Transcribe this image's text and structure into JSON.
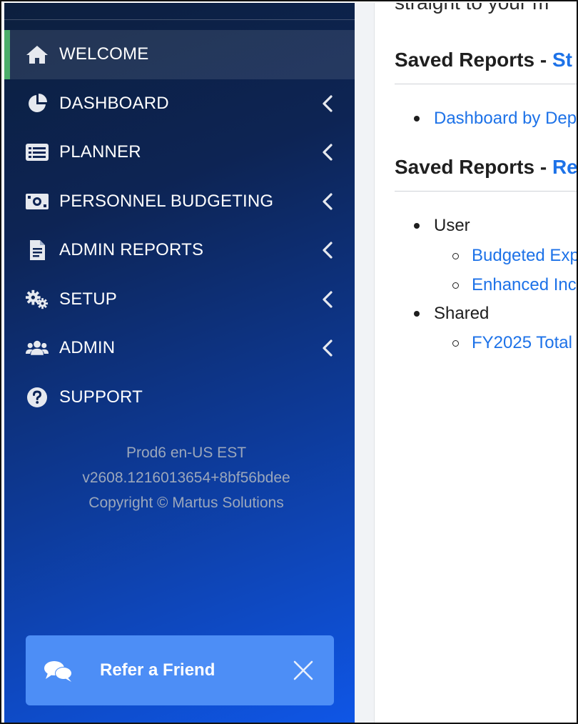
{
  "nav": {
    "items": [
      {
        "label": "WELCOME",
        "icon": "home-icon",
        "active": true
      },
      {
        "label": "DASHBOARD",
        "icon": "pie-chart-icon"
      },
      {
        "label": "PLANNER",
        "icon": "list-icon"
      },
      {
        "label": "PERSONNEL BUDGETING",
        "icon": "money-icon"
      },
      {
        "label": "ADMIN REPORTS",
        "icon": "report-icon"
      },
      {
        "label": "SETUP",
        "icon": "gears-icon"
      },
      {
        "label": "ADMIN",
        "icon": "users-icon"
      },
      {
        "label": "SUPPORT",
        "icon": "question-icon"
      }
    ]
  },
  "meta": {
    "env": "Prod6 en-US EST",
    "version": "v2608.1216013654+8bf56bdee",
    "copyright": "Copyright © Martus Solutions"
  },
  "refer": {
    "label": "Refer a Friend"
  },
  "content": {
    "intro": "straight to your m",
    "sections": [
      {
        "title_prefix": "Saved Reports - ",
        "title_link": "St"
      },
      {
        "title_prefix": "Saved Reports - ",
        "title_link": "Re"
      }
    ],
    "section1_links": [
      "Dashboard by Dep"
    ],
    "groups": [
      {
        "label": "User",
        "links": [
          "Budgeted Exp",
          "Enhanced Inc"
        ]
      },
      {
        "label": "Shared",
        "links": [
          "FY2025 Total"
        ]
      }
    ]
  },
  "colors": {
    "accent_active": "#4cae6a",
    "link": "#1d72e8",
    "refer_bg": "#4d8ef6"
  }
}
